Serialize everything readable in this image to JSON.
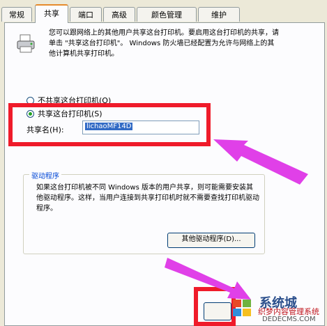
{
  "tabs": [
    {
      "label": "常规",
      "active": false
    },
    {
      "label": "共享",
      "active": true
    },
    {
      "label": "端口",
      "active": false
    },
    {
      "label": "高级",
      "active": false
    },
    {
      "label": "颜色管理",
      "active": false
    },
    {
      "label": "维护",
      "active": false
    }
  ],
  "description": "您可以跟网络上的其他用户共享这台打印机。要启用这台打印机的共享，请单击 \"共享这台打印机\"。 Windows 防火墙已经配置为允许与网络上的其他计算机共享打印机。",
  "radio_no_share": "不共享这台打印机(O)",
  "radio_share": "共享这台打印机(S)",
  "share_name_label": "共享名(H):",
  "share_name_value": "lichaoMF14D",
  "drivers_group_title": "驱动程序",
  "drivers_text": "如果这台打印机被不同 Windows 版本的用户共享，则可能需要安装其他驱动程序。这样，当用户连接到共享打印机时就不需要查找打印机驱动程序。",
  "other_drivers_button": "其他驱动程序(D)...",
  "watermark": {
    "brand": "系统城",
    "title": "织梦内容管理系统",
    "site": "DEDECMS.COM"
  },
  "colors": {
    "highlight_red": "#ef1b2a",
    "arrow_magenta": "#e040e8",
    "tab_accent": "#e68b2c"
  }
}
